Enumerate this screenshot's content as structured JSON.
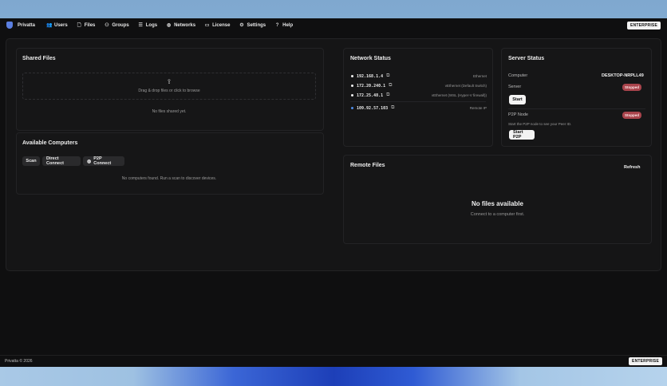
{
  "app": {
    "brand": "Privatta",
    "edition_badge": "ENTERPRISE"
  },
  "nav": {
    "items": [
      {
        "label": "Users",
        "icon": "users-icon",
        "glyph": "👥"
      },
      {
        "label": "Files",
        "icon": "file-icon",
        "glyph": "🗋"
      },
      {
        "label": "Groups",
        "icon": "group-icon",
        "glyph": "⚇"
      },
      {
        "label": "Logs",
        "icon": "log-icon",
        "glyph": "☰"
      },
      {
        "label": "Networks",
        "icon": "globe-icon",
        "glyph": "◍"
      },
      {
        "label": "License",
        "icon": "license-icon",
        "glyph": "▭"
      },
      {
        "label": "Settings",
        "icon": "gear-icon",
        "glyph": "⚙"
      },
      {
        "label": "Help",
        "icon": "help-icon",
        "glyph": "?"
      }
    ]
  },
  "shared_files": {
    "title": "Shared Files",
    "dropzone_text": "Drag & drop files or click to browse",
    "empty_text": "No files shared yet."
  },
  "available_computers": {
    "title": "Available Computers",
    "buttons": [
      "Scan",
      "Direct Connect",
      "P2P Connect"
    ],
    "empty_text": "No computers found. Run a scan to discover devices."
  },
  "network_status": {
    "title": "Network Status",
    "interfaces": [
      {
        "ip": "192.168.1.4",
        "label": "Ethernet"
      },
      {
        "ip": "172.20.240.1",
        "label": "vEthernet (Default Switch)"
      },
      {
        "ip": "172.25.48.1",
        "label": "vEthernet (WSL (Hyper-V firewall))"
      }
    ],
    "remote": {
      "ip": "109.92.57.103",
      "label": "Remote IP"
    }
  },
  "server_status": {
    "title": "Server Status",
    "computer_label": "Computer",
    "computer_value": "DESKTOP-NRPLL49",
    "server_label": "Server",
    "server_status": "Stopped",
    "start_button": "Start",
    "p2p_label": "P2P Node",
    "p2p_status": "Stopped",
    "p2p_hint": "Start the P2P node to see your Peer ID.",
    "start_p2p_button": "Start P2P"
  },
  "remote_files": {
    "title": "Remote Files",
    "refresh": "Refresh",
    "empty_title": "No files available",
    "empty_sub": "Connect to a computer first."
  },
  "footer": {
    "copyright": "Privatta © 2026",
    "edition_badge": "ENTERPRISE"
  },
  "colors": {
    "background": "#0f0f10",
    "card": "#161617",
    "stopped_badge": "#a9444c",
    "remote_dot": "#4f8de8"
  }
}
